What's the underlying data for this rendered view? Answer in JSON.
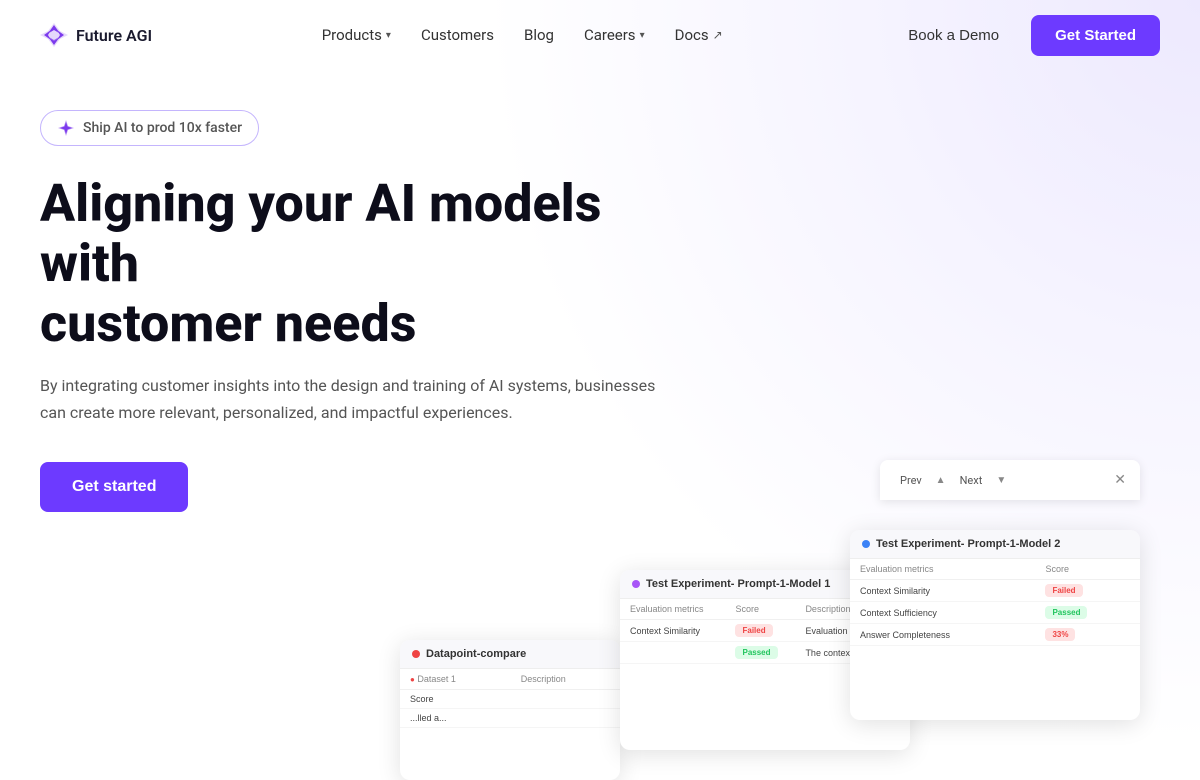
{
  "brand": {
    "name": "Future AGI",
    "logo_text": "Future AGI"
  },
  "nav": {
    "links": [
      {
        "label": "Products",
        "has_dropdown": true,
        "id": "products"
      },
      {
        "label": "Customers",
        "has_dropdown": false,
        "id": "customers"
      },
      {
        "label": "Blog",
        "has_dropdown": false,
        "id": "blog"
      },
      {
        "label": "Careers",
        "has_dropdown": true,
        "id": "careers"
      },
      {
        "label": "Docs",
        "has_dropdown": false,
        "external": true,
        "id": "docs"
      }
    ],
    "book_demo": "Book a Demo",
    "get_started": "Get Started"
  },
  "hero": {
    "badge_text": "Ship AI to prod 10x faster",
    "title_line1": "Aligning your AI models with",
    "title_line2": "customer needs",
    "subtitle": "By integrating customer insights into the design and training of AI systems, businesses can create more relevant, personalized, and impactful experiences.",
    "cta_label": "Get started"
  },
  "preview": {
    "nav_prev": "Prev",
    "nav_next": "Next",
    "card1": {
      "title": "Datapoint-compare",
      "dot_color": "#ef4444",
      "dataset_label": "Dataset 1",
      "columns": [
        "",
        "Description"
      ],
      "score_label": "Score",
      "row1_text": "...lled a..."
    },
    "card2": {
      "title": "Test Experiment- Prompt-1-Model 1",
      "dot_color": "#a855f7",
      "columns": [
        "Evaluation metrics",
        "Score",
        "Description"
      ],
      "rows": [
        {
          "metric": "Context Similarity",
          "score": "Failed",
          "score_type": "failed",
          "desc": "Evaluation failed a..."
        },
        {
          "metric": "",
          "score": "Passed",
          "score_type": "passed",
          "desc": "The context provid..."
        }
      ]
    },
    "card3": {
      "title": "Test Experiment- Prompt-1-Model 2",
      "dot_color": "#3b82f6",
      "columns": [
        "Evaluation metrics",
        "Score"
      ],
      "rows": [
        {
          "metric": "Context Similarity",
          "score": "Failed",
          "score_type": "failed"
        },
        {
          "metric": "Context Sufficiency",
          "score": "Passed",
          "score_type": "passed"
        },
        {
          "metric": "Answer Completeness",
          "score": "33%",
          "score_type": "failed"
        }
      ]
    }
  },
  "colors": {
    "brand_purple": "#6d3aff",
    "text_dark": "#0d0d1a",
    "text_muted": "#555555"
  }
}
